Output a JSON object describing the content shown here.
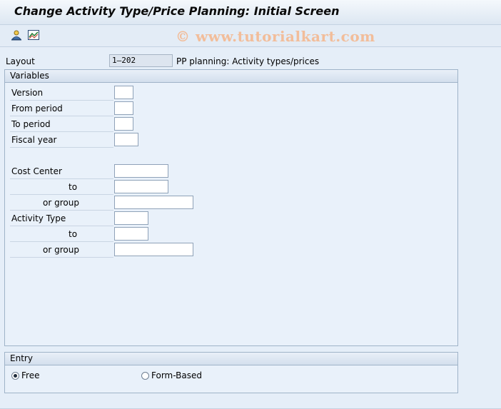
{
  "header": {
    "title": "Change Activity Type/Price Planning: Initial Screen"
  },
  "toolbar": {
    "icons": [
      "person-overview-icon",
      "chart-line-icon"
    ],
    "watermark": "© www.tutorialkart.com"
  },
  "layout": {
    "label": "Layout",
    "value": "1–202",
    "description": "PP planning: Activity types/prices"
  },
  "variables": {
    "title": "Variables",
    "version_label": "Version",
    "version_value": "",
    "from_period_label": "From period",
    "from_period_value": "",
    "to_period_label": "To period",
    "to_period_value": "",
    "fiscal_year_label": "Fiscal year",
    "fiscal_year_value": "",
    "cost_center_label": "Cost Center",
    "cost_center_value": "",
    "cost_center_to_label": "to",
    "cost_center_to_value": "",
    "cost_center_group_label": "or group",
    "cost_center_group_value": "",
    "activity_type_label": "Activity Type",
    "activity_type_value": "",
    "activity_type_to_label": "to",
    "activity_type_to_value": "",
    "activity_type_group_label": "or group",
    "activity_type_group_value": ""
  },
  "entry": {
    "title": "Entry",
    "options": [
      {
        "label": "Free",
        "selected": true
      },
      {
        "label": "Form-Based",
        "selected": false
      }
    ]
  }
}
